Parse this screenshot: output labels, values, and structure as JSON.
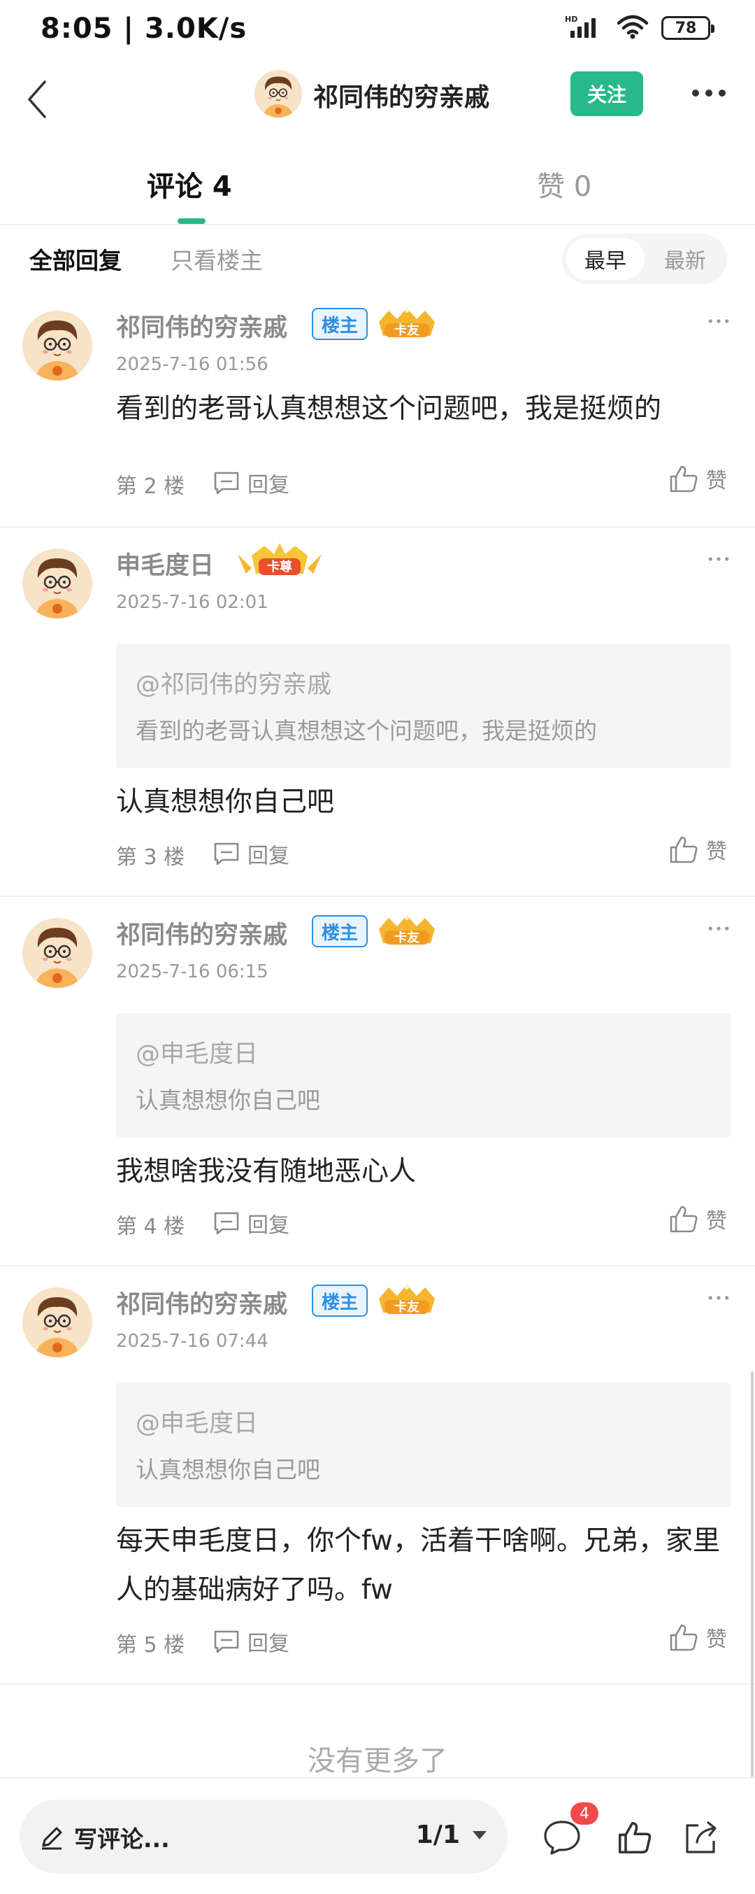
{
  "status_bar": {
    "time": "8:05 | 3.0K/s",
    "network": "HD",
    "battery": "78"
  },
  "nav": {
    "title": "祁同伟的穷亲戚",
    "follow_label": "关注"
  },
  "tabs": {
    "comments": "评论 4",
    "likes": "赞 0"
  },
  "filter": {
    "all": "全部回复",
    "op_only": "只看楼主",
    "sort_early": "最早",
    "sort_new": "最新"
  },
  "badges": {
    "op": "楼主",
    "fan": "卡友",
    "vip": "卡尊"
  },
  "comments": [
    {
      "name": "祁同伟的穷亲戚",
      "date": "2025-7-16 01:56",
      "text": "看到的老哥认真想想这个问题吧，我是挺烦的",
      "floor": "第 2 楼",
      "reply": "回复",
      "like": "赞"
    },
    {
      "name": "申毛度日",
      "date": "2025-7-16 02:01",
      "quote_at": "@祁同伟的穷亲戚",
      "quote_text": "看到的老哥认真想想这个问题吧，我是挺烦的",
      "text": "认真想想你自己吧",
      "floor": "第 3 楼",
      "reply": "回复",
      "like": "赞"
    },
    {
      "name": "祁同伟的穷亲戚",
      "date": "2025-7-16 06:15",
      "quote_at": "@申毛度日",
      "quote_text": "认真想想你自己吧",
      "text": "我想啥我没有随地恶心人",
      "floor": "第 4 楼",
      "reply": "回复",
      "like": "赞"
    },
    {
      "name": "祁同伟的穷亲戚",
      "date": "2025-7-16 07:44",
      "quote_at": "@申毛度日",
      "quote_text": "认真想想你自己吧",
      "text": "每天申毛度日，你个fw，活着干啥啊。兄弟，家里人的基础病好了吗。fw",
      "floor": "第 5 楼",
      "reply": "回复",
      "like": "赞"
    }
  ],
  "footer": {
    "no_more": "没有更多了",
    "write_placeholder": "写评论...",
    "page": "1/1",
    "comment_badge": "4"
  },
  "colors": {
    "accent": "#27b98a",
    "op_badge": "#2f8fe0",
    "notify": "#f04a4a"
  }
}
